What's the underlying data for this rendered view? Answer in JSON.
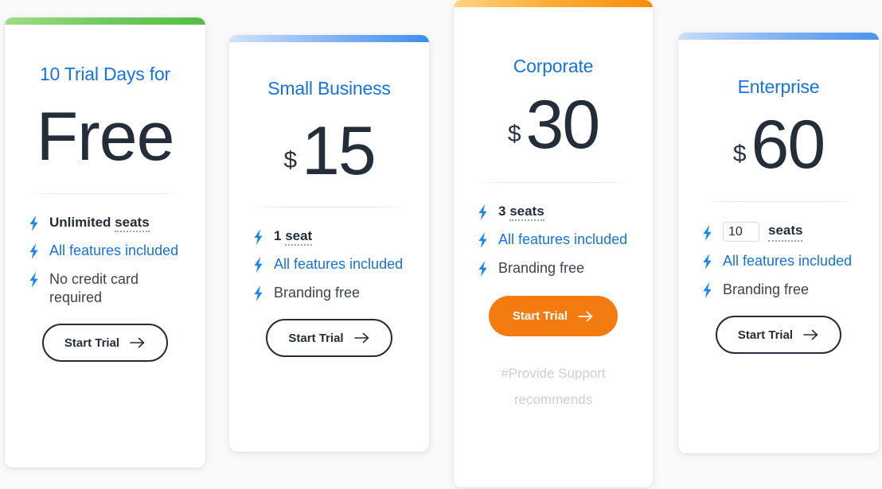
{
  "plans": [
    {
      "id": "free",
      "accent_color": "#6ec85a",
      "title": "10 Trial Days for",
      "price_display": "Free",
      "currency": "",
      "amount": "",
      "features": [
        {
          "text": "Unlimited seats",
          "style": "bold",
          "dotted_word": "seats"
        },
        {
          "text": "All features included",
          "style": "accent"
        },
        {
          "text": "No credit card required",
          "style": "normal"
        }
      ],
      "button": {
        "label": "Start Trial",
        "style": "outline"
      },
      "note": ""
    },
    {
      "id": "small-business",
      "accent_color": "#3e8ded",
      "title": "Small Business",
      "price_display": "$15",
      "currency": "$",
      "amount": "15",
      "features": [
        {
          "text": "1 seat",
          "style": "bold",
          "dotted_word": "seat"
        },
        {
          "text": "All features included",
          "style": "accent"
        },
        {
          "text": "Branding free",
          "style": "normal"
        }
      ],
      "button": {
        "label": "Start Trial",
        "style": "outline"
      },
      "note": ""
    },
    {
      "id": "corporate",
      "accent_color": "#f78d0a",
      "title": "Corporate",
      "price_display": "$30",
      "currency": "$",
      "amount": "30",
      "features": [
        {
          "text": "3 seats",
          "style": "bold",
          "dotted_word": "seats"
        },
        {
          "text": "All features included",
          "style": "accent"
        },
        {
          "text": "Branding free",
          "style": "normal"
        }
      ],
      "button": {
        "label": "Start Trial",
        "style": "solid",
        "color": "#f47b10"
      },
      "note_line1": "#Provide Support",
      "note_line2": "recommends"
    },
    {
      "id": "enterprise",
      "accent_color": "#4b93ec",
      "title": "Enterprise",
      "price_display": "$60",
      "currency": "$",
      "amount": "60",
      "seat_input_value": "10",
      "seat_input_label": "seats",
      "features": [
        {
          "text": "All features included",
          "style": "accent"
        },
        {
          "text": "Branding free",
          "style": "normal"
        }
      ],
      "button": {
        "label": "Start Trial",
        "style": "outline"
      },
      "note": ""
    }
  ],
  "icons": {
    "bolt": "lightning-bolt-icon",
    "arrow": "arrow-right-icon"
  },
  "colors": {
    "link_blue": "#1773e0",
    "text_dark": "#242e3a",
    "orange_cta": "#f47b10",
    "note_gray": "#cbcfd6"
  }
}
